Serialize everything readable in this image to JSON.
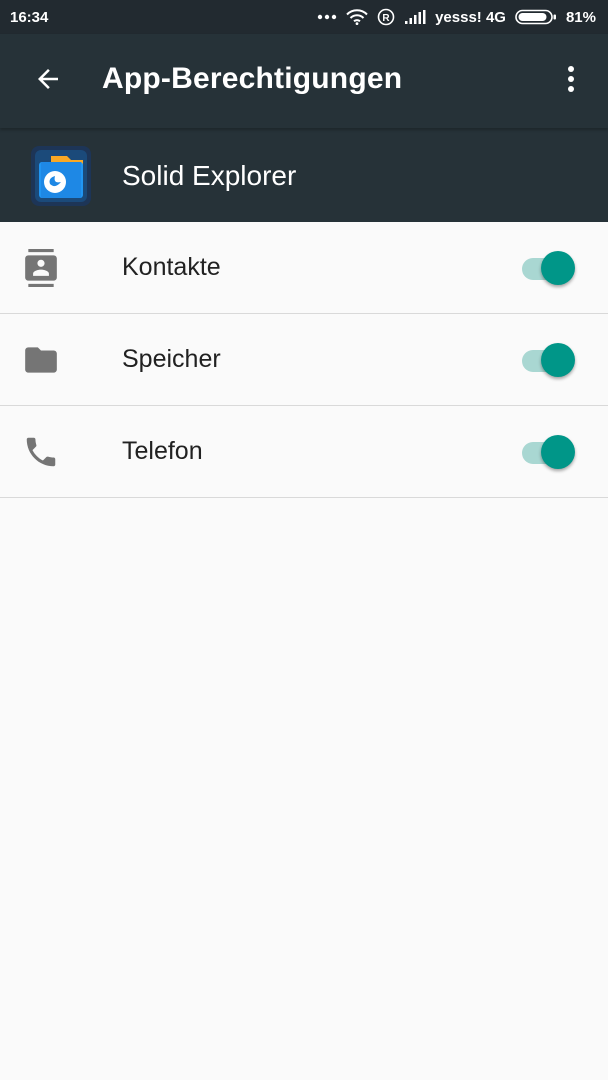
{
  "status_bar": {
    "time": "16:34",
    "carrier": "yesss! 4G",
    "battery": "81%",
    "icons": [
      "more-dots-icon",
      "wifi-icon",
      "roaming-r-icon",
      "signal-icon",
      "battery-icon"
    ]
  },
  "app_bar": {
    "title": "App-Berechtigungen",
    "back_icon": "arrow-back-icon",
    "menu_icon": "more-vert-icon"
  },
  "app": {
    "name": "Solid Explorer",
    "icon": "solid-explorer-app-icon"
  },
  "permissions": [
    {
      "label": "Kontakte",
      "icon": "contacts-icon",
      "enabled": true
    },
    {
      "label": "Speicher",
      "icon": "folder-icon",
      "enabled": true
    },
    {
      "label": "Telefon",
      "icon": "phone-icon",
      "enabled": true
    }
  ],
  "colors": {
    "status_bar": "#222a30",
    "app_bar": "#263238",
    "background": "#fafafa",
    "accent": "#009688",
    "toggle_track": "#a9d7d2",
    "icon_grey": "#757575"
  }
}
